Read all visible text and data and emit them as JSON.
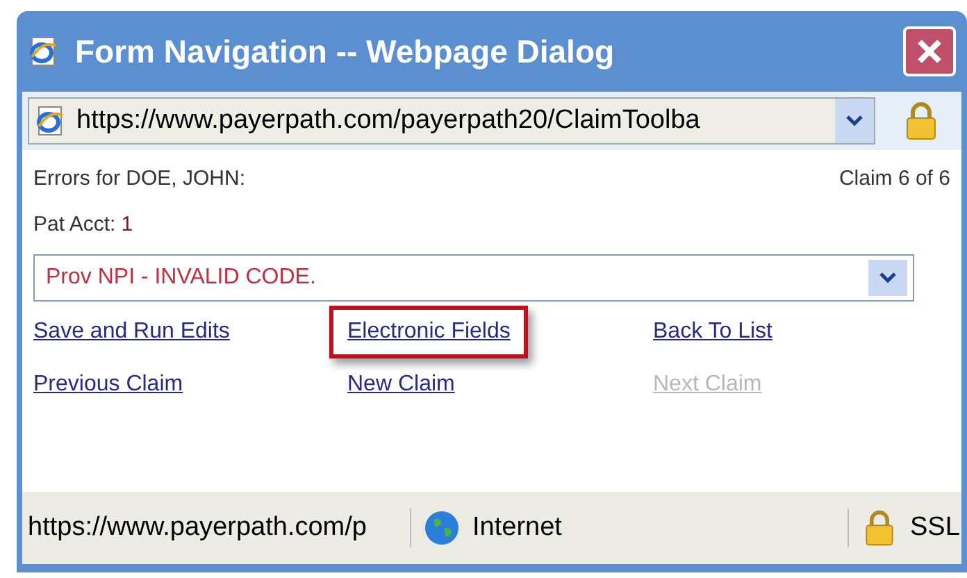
{
  "window": {
    "title": "Form Navigation -- Webpage Dialog"
  },
  "address_bar": {
    "url": "https://www.payerpath.com/payerpath20/ClaimToolba"
  },
  "header": {
    "errors_label": "Errors for DOE, JOHN:",
    "claim_count": "Claim 6 of 6"
  },
  "patient_account": {
    "label": "Pat Acct:",
    "value": "1"
  },
  "error_dropdown": {
    "value": "Prov NPI - INVALID CODE."
  },
  "links": [
    {
      "label": "Save and Run Edits",
      "disabled": false,
      "highlighted": false
    },
    {
      "label": "Electronic Fields",
      "disabled": false,
      "highlighted": true
    },
    {
      "label": "Back To List",
      "disabled": false,
      "highlighted": false
    },
    {
      "label": "Previous Claim",
      "disabled": false,
      "highlighted": false
    },
    {
      "label": "New Claim",
      "disabled": false,
      "highlighted": false
    },
    {
      "label": "Next Claim",
      "disabled": true,
      "highlighted": false
    }
  ],
  "status_bar": {
    "url": "https://www.payerpath.com/p",
    "zone": "Internet",
    "security": "SSL"
  }
}
